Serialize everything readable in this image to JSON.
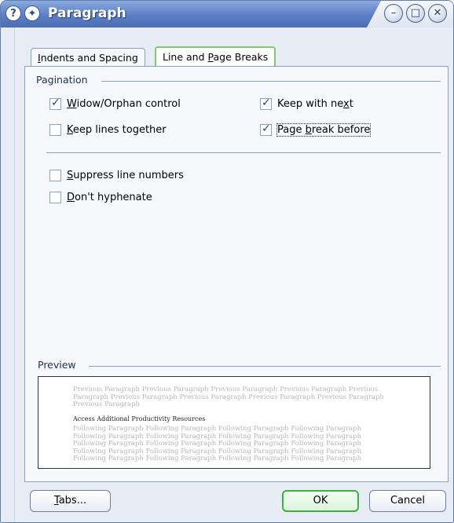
{
  "window": {
    "title": "Paragraph",
    "title_icons": {
      "help": "?",
      "pin": "✦"
    },
    "controls": {
      "minimize": "–",
      "maximize": "□",
      "close": "✕"
    }
  },
  "tabs": [
    {
      "label_pre": "",
      "accel": "I",
      "label_post": "ndents and Spacing",
      "active": false
    },
    {
      "label_pre": "Line and ",
      "accel": "P",
      "label_post": "age Breaks",
      "active": true
    }
  ],
  "pagination": {
    "label": "Pagination",
    "options": [
      {
        "pre": "",
        "accel": "W",
        "post": "idow/Orphan control",
        "checked": true
      },
      {
        "pre": "Keep with ne",
        "accel": "x",
        "post": "t",
        "checked": true
      },
      {
        "pre": "",
        "accel": "K",
        "post": "eep lines together",
        "checked": false
      },
      {
        "pre": "Page ",
        "accel": "b",
        "post": "reak before",
        "checked": true
      }
    ]
  },
  "other_options": [
    {
      "pre": "",
      "accel": "S",
      "post": "uppress line numbers",
      "checked": false
    },
    {
      "pre": "",
      "accel": "D",
      "post": "on't hyphenate",
      "checked": false
    }
  ],
  "preview": {
    "label": "Preview",
    "previous_text": "Previous Paragraph Previous Paragraph Previous Paragraph Previous Paragraph Previous Paragraph Previous Paragraph Previous Paragraph Previous Paragraph Previous Paragraph Previous Paragraph",
    "current_text": "Access Additional Productivity Resources",
    "following_text": "Following Paragraph Following Paragraph Following Paragraph Following Paragraph Following Paragraph Following Paragraph Following Paragraph Following Paragraph Following Paragraph Following Paragraph Following Paragraph Following Paragraph Following Paragraph Following Paragraph Following Paragraph Following Paragraph Following Paragraph Following Paragraph Following Paragraph Following Paragraph"
  },
  "buttons": {
    "tabs": {
      "accel": "T",
      "post": "abs..."
    },
    "ok": "OK",
    "cancel": "Cancel"
  },
  "colors": {
    "active_tab_border": "#7ec86f",
    "ok_border": "#3fae45",
    "title_bar": "#5c7fc4"
  }
}
